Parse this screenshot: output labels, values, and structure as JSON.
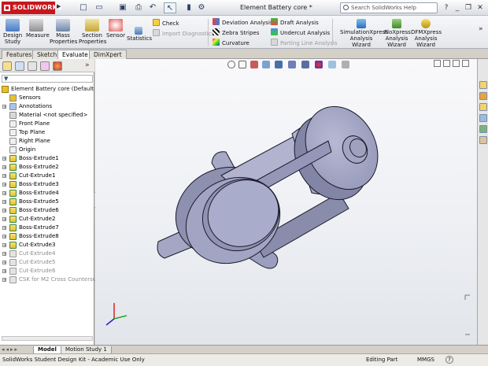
{
  "app": {
    "brand": "SOLIDWORKS",
    "doc_title": "Element Battery core *",
    "search_placeholder": "Search SolidWorks Help"
  },
  "ribbon": {
    "design_study": "Design Study",
    "measure": "Measure",
    "mass_properties": "Mass Properties",
    "section_properties": "Section Properties",
    "sensor": "Sensor",
    "statistics": "Statistics",
    "check": "Check",
    "import_diagnostics": "Import Diagnostics",
    "deviation_analysis": "Deviation Analysis",
    "zebra_stripes": "Zebra Stripes",
    "curvature": "Curvature",
    "draft_analysis": "Draft Analysis",
    "undercut_analysis": "Undercut Analysis",
    "parting_line_analysis": "Parting Line Analysis",
    "simulationxpress": "SimulationXpress Analysis Wizard",
    "floxpress": "FloXpress Analysis Wizard",
    "dfmxpress": "DFMXpress Analysis Wizard"
  },
  "tabs": [
    "Features",
    "Sketch",
    "Evaluate",
    "DimXpert"
  ],
  "active_tab": "Evaluate",
  "tree": {
    "root": "Element Battery core  (Default<<De",
    "items": [
      {
        "label": "Sensors",
        "expand": false,
        "state": "normal"
      },
      {
        "label": "Annotations",
        "expand": true,
        "state": "normal"
      },
      {
        "label": "Material <not specified>",
        "expand": false,
        "state": "normal"
      },
      {
        "label": "Front Plane",
        "expand": false,
        "state": "normal"
      },
      {
        "label": "Top Plane",
        "expand": false,
        "state": "normal"
      },
      {
        "label": "Right Plane",
        "expand": false,
        "state": "normal"
      },
      {
        "label": "Origin",
        "expand": false,
        "state": "normal"
      },
      {
        "label": "Boss-Extrude1",
        "expand": true,
        "state": "normal"
      },
      {
        "label": "Boss-Extrude2",
        "expand": true,
        "state": "normal"
      },
      {
        "label": "Cut-Extrude1",
        "expand": true,
        "state": "normal"
      },
      {
        "label": "Boss-Extrude3",
        "expand": true,
        "state": "normal"
      },
      {
        "label": "Boss-Extrude4",
        "expand": true,
        "state": "normal"
      },
      {
        "label": "Boss-Extrude5",
        "expand": true,
        "state": "normal"
      },
      {
        "label": "Boss-Extrude6",
        "expand": true,
        "state": "normal"
      },
      {
        "label": "Cut-Extrude2",
        "expand": true,
        "state": "normal"
      },
      {
        "label": "Boss-Extrude7",
        "expand": true,
        "state": "normal"
      },
      {
        "label": "Boss-Extrude8",
        "expand": true,
        "state": "normal"
      },
      {
        "label": "Cut-Extrude3",
        "expand": true,
        "state": "normal"
      },
      {
        "label": "Cut-Extrude4",
        "expand": true,
        "state": "suppressed"
      },
      {
        "label": "Cut-Extrude5",
        "expand": true,
        "state": "suppressed"
      },
      {
        "label": "Cut-Extrude6",
        "expand": true,
        "state": "suppressed"
      },
      {
        "label": "CSK for M2 Cross Countersunk I",
        "expand": true,
        "state": "suppressed"
      }
    ]
  },
  "bottom_tabs": [
    "Model",
    "Motion Study 1"
  ],
  "status": {
    "left": "SolidWorks Student Design Kit - Academic Use Only",
    "editing": "Editing Part",
    "units": "MMGS",
    "help": "?"
  },
  "colors": {
    "brand_red": "#c8161d",
    "part_face": "#a4a6c4",
    "part_shadow": "#7d7f9f",
    "part_highlight": "#c3c5dd",
    "feature_icon": "#e8c12a",
    "suppressed_text": "#8d8d8d"
  },
  "icons": {
    "search": "search-icon",
    "tree_feature": "boss-extrude-icon",
    "origin": "origin-icon",
    "plane": "plane-icon"
  }
}
